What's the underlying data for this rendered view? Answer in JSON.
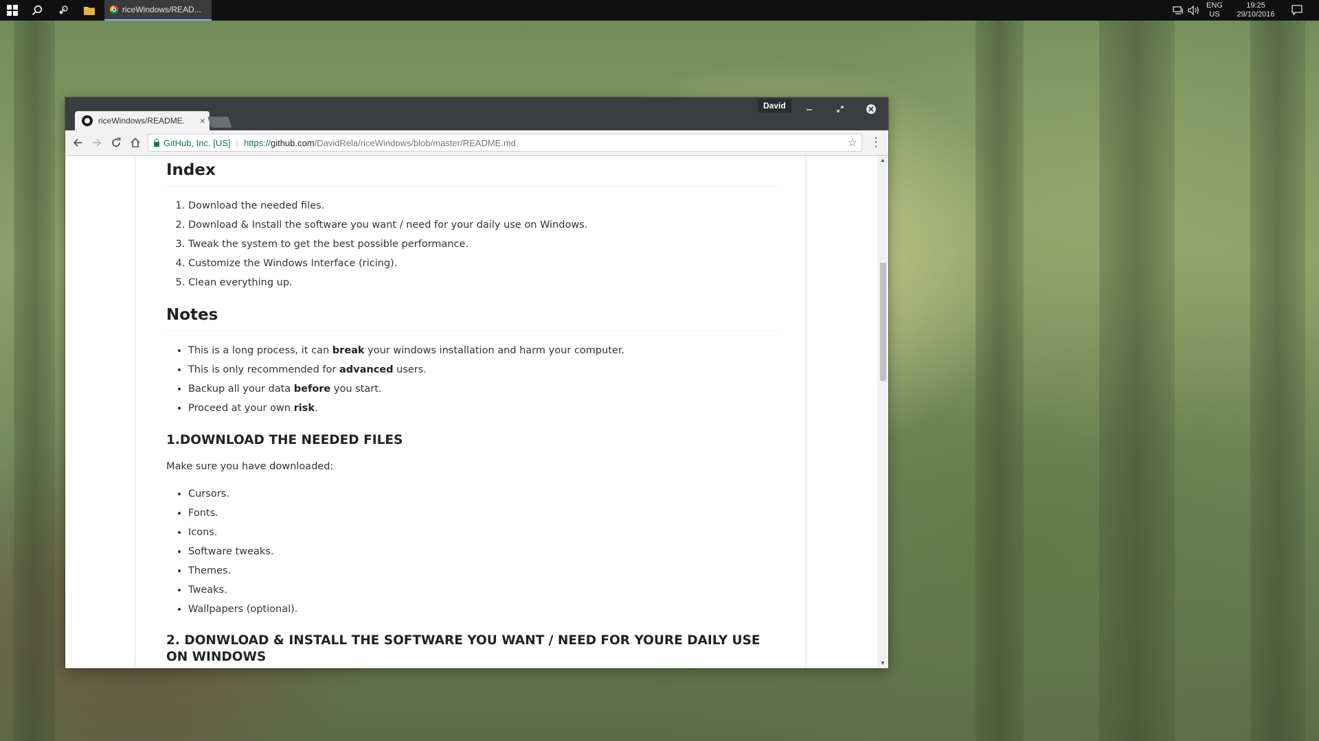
{
  "taskbar": {
    "task_title": "riceWindows/READ...",
    "tray_lang_1": "ENG",
    "tray_lang_2": "US",
    "clock_time": "19:25",
    "clock_date": "29/10/2016"
  },
  "browser": {
    "profile_name": "David",
    "tab_title": "riceWindows/README.",
    "tab_close": "×",
    "site_identity": "GitHub, Inc. [US]",
    "url_scheme": "https://",
    "url_host": "github.com",
    "url_path": "/DavidRela/riceWindows/blob/master/README.md"
  },
  "readme": {
    "index_heading": "Index",
    "index_items": [
      "Download the needed files.",
      "Download & Install the software you want / need for your daily use on Windows.",
      "Tweak the system to get the best possible performance.",
      "Customize the Windows Interface (ricing).",
      "Clean everything up."
    ],
    "notes_heading": "Notes",
    "notes": [
      {
        "pre": "This is a long process, it can ",
        "bold": "break",
        "post": " your windows installation and harm your computer."
      },
      {
        "pre": "This is only recommended for ",
        "bold": "advanced",
        "post": " users."
      },
      {
        "pre": "Backup all your data ",
        "bold": "before",
        "post": " you start."
      },
      {
        "pre": "Proceed at your own ",
        "bold": "risk",
        "post": "."
      }
    ],
    "section1_heading": "1.DOWNLOAD THE NEEDED FILES",
    "section1_intro": "Make sure you have downloaded:",
    "section1_items": [
      "Cursors.",
      "Fonts.",
      "Icons.",
      "Software tweaks.",
      "Themes.",
      "Tweaks.",
      "Wallpapers (optional)."
    ],
    "section2_heading": "2. DONWLOAD & INSTALL THE SOFTWARE YOU WANT / NEED FOR YOURE DAILY USE ON WINDOWS"
  }
}
